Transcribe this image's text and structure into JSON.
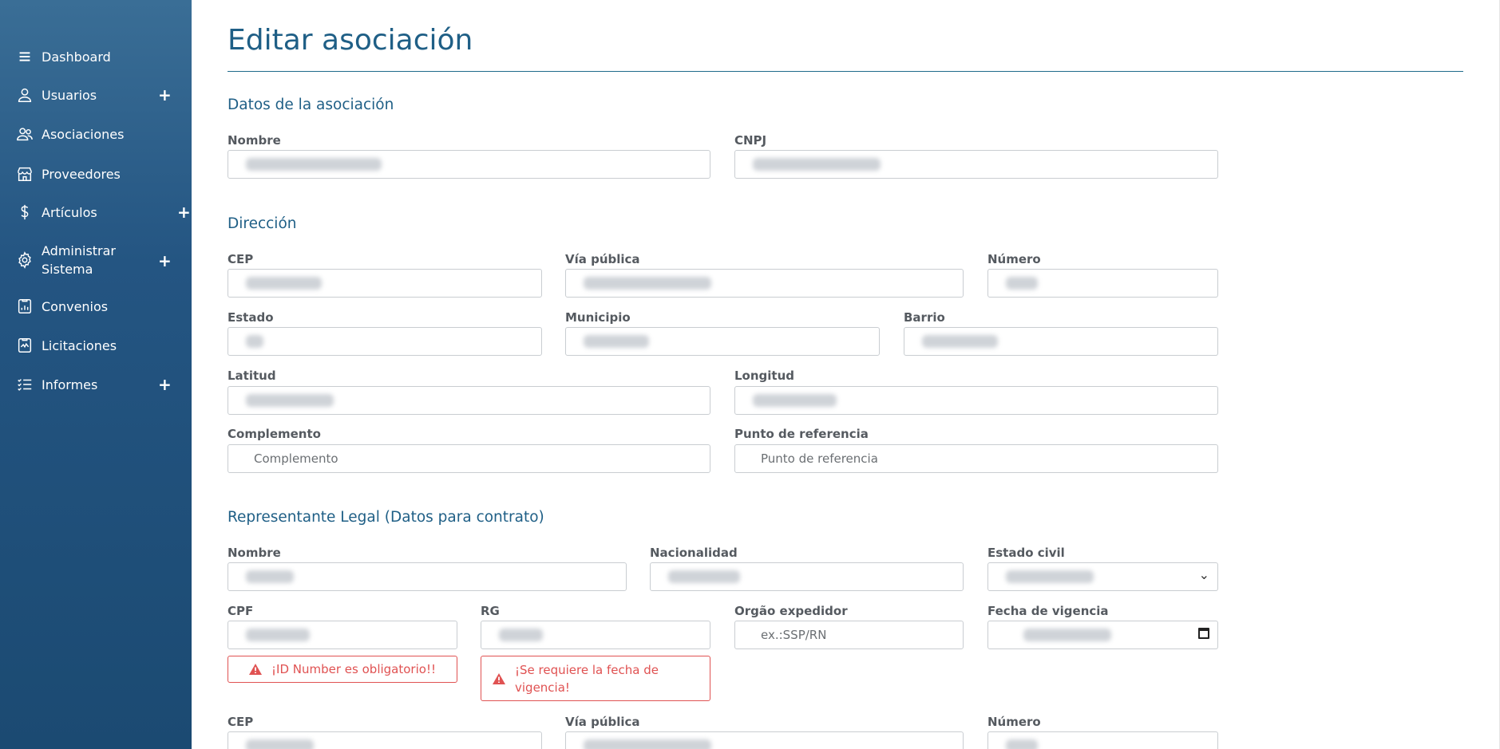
{
  "sidebar": {
    "items": [
      {
        "label": "Dashboard",
        "icon": "menu-icon"
      },
      {
        "label": "Usuarios",
        "icon": "user-icon",
        "expand": "+"
      },
      {
        "label": "Asociaciones",
        "icon": "users-icon"
      },
      {
        "label": "Proveedores",
        "icon": "store-icon"
      },
      {
        "label": "Artículos",
        "icon": "dollar-icon",
        "expand": "+"
      },
      {
        "label": "Administrar Sistema",
        "icon": "gear-icon",
        "expand": "+"
      },
      {
        "label": "Convenios",
        "icon": "report-icon"
      },
      {
        "label": "Licitaciones",
        "icon": "chart-doc-icon"
      },
      {
        "label": "Informes",
        "icon": "list-icon",
        "expand": "+"
      }
    ]
  },
  "page": {
    "title": "Editar asociación"
  },
  "sections": {
    "asociacion": "Datos de la asociación",
    "direccion": "Dirección",
    "representante": "Representante Legal (Datos para contrato)"
  },
  "fields": {
    "nombre": "Nombre",
    "cnpj": "CNPJ",
    "cep": "CEP",
    "via_publica": "Vía pública",
    "numero": "Número",
    "estado": "Estado",
    "municipio": "Municipio",
    "barrio": "Barrio",
    "latitud": "Latitud",
    "longitud": "Longitud",
    "complemento": "Complemento",
    "complemento_placeholder": "Complemento",
    "punto_referencia": "Punto de referencia",
    "punto_referencia_placeholder": "Punto de referencia",
    "rep_nombre": "Nombre",
    "nacionalidad": "Nacionalidad",
    "estado_civil": "Estado civil",
    "cpf": "CPF",
    "rg": "RG",
    "orgao": "Orgão expedidor",
    "orgao_placeholder": "ex.:SSP/RN",
    "fecha_vigencia": "Fecha de vigencia",
    "rep_cep": "CEP",
    "rep_via_publica": "Vía pública",
    "rep_numero": "Número"
  },
  "errors": {
    "id_number": "¡ID Number es obligatorio!!",
    "fecha_vigencia": "¡Se requiere la fecha de vigencia!"
  },
  "colors": {
    "accent": "#1f5f86",
    "error": "#e05252",
    "sidebar": "#245582"
  }
}
